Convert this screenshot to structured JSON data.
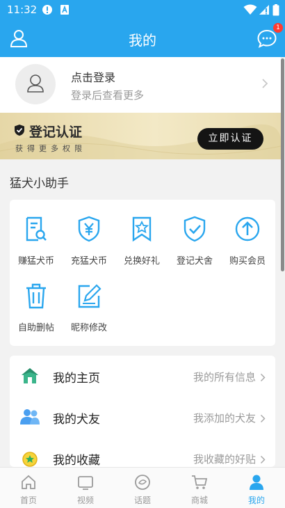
{
  "status_bar": {
    "time": "11:32"
  },
  "header": {
    "title": "我的",
    "message_badge": "1"
  },
  "login": {
    "title": "点击登录",
    "subtitle": "登录后查看更多"
  },
  "certification": {
    "title": "登记认证",
    "subtitle": "获得更多权限",
    "button": "立即认证"
  },
  "assistant": {
    "title": "猛犬小助手",
    "items": [
      {
        "label": "赚猛犬币",
        "icon": "search-document-icon"
      },
      {
        "label": "充猛犬币",
        "icon": "yen-shield-icon"
      },
      {
        "label": "兑换好礼",
        "icon": "star-bookmark-icon"
      },
      {
        "label": "登记犬舍",
        "icon": "check-shield-icon"
      },
      {
        "label": "购买会员",
        "icon": "up-arrow-circle-icon"
      },
      {
        "label": "自助删帖",
        "icon": "trash-icon"
      },
      {
        "label": "昵称修改",
        "icon": "edit-icon"
      }
    ]
  },
  "menu": [
    {
      "title": "我的主页",
      "hint": "我的所有信息",
      "icon": "home-icon"
    },
    {
      "title": "我的犬友",
      "hint": "我添加的犬友",
      "icon": "friends-icon"
    },
    {
      "title": "我的收藏",
      "hint": "我收藏的好贴",
      "icon": "star-medal-icon"
    }
  ],
  "tabs": [
    {
      "label": "首页",
      "icon": "home-tab-icon"
    },
    {
      "label": "视频",
      "icon": "video-tab-icon"
    },
    {
      "label": "话题",
      "icon": "topic-tab-icon"
    },
    {
      "label": "商城",
      "icon": "cart-tab-icon"
    },
    {
      "label": "我的",
      "icon": "profile-tab-icon",
      "active": true
    }
  ],
  "colors": {
    "primary": "#29a6ee",
    "banner_gold": "#e6d7a7",
    "badge": "#ff3b30"
  }
}
